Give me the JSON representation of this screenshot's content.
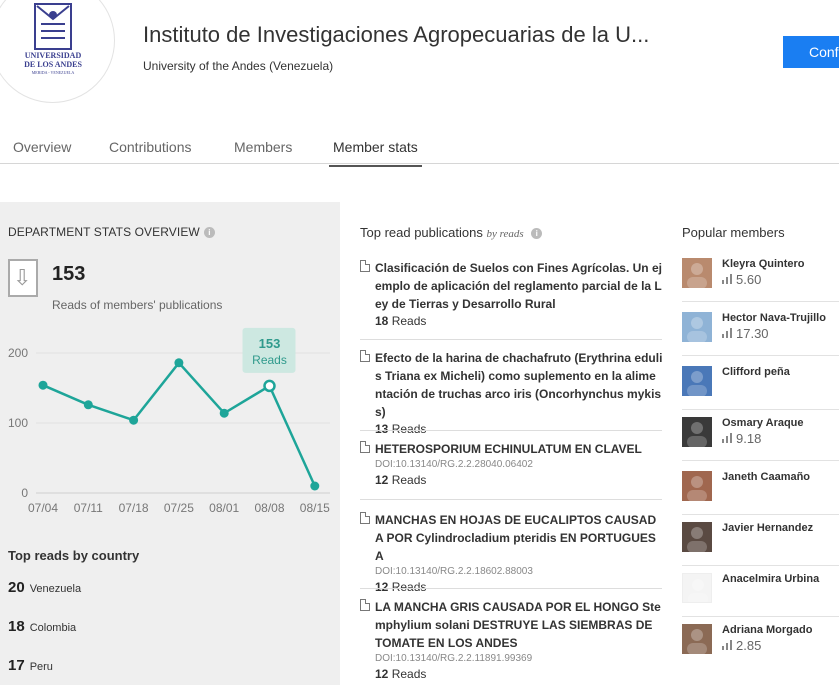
{
  "header": {
    "logo_lines": [
      "UNIVERSIDAD",
      "DE LOS ANDES",
      "MERIDA - VENEZUELA"
    ],
    "title": "Instituto de Investigaciones Agropecuarias de la U...",
    "subtitle": "University of the Andes (Venezuela)",
    "confirm_label": "Conf"
  },
  "tabs": [
    {
      "label": "Overview",
      "active": false
    },
    {
      "label": "Contributions",
      "active": false
    },
    {
      "label": "Members",
      "active": false
    },
    {
      "label": "Member stats",
      "active": true
    }
  ],
  "stats": {
    "heading": "DEPARTMENT STATS OVERVIEW",
    "info_glyph": "i",
    "arrow_glyph": "⇩",
    "reads_total": "153",
    "reads_label": "Reads of members' publications"
  },
  "chart_data": {
    "type": "line",
    "categories": [
      "07/04",
      "07/11",
      "07/18",
      "07/25",
      "08/01",
      "08/08",
      "08/15"
    ],
    "values": [
      154,
      126,
      104,
      186,
      114,
      153,
      10
    ],
    "ylim": [
      0,
      200
    ],
    "yticks": [
      "0",
      "100",
      "200"
    ],
    "highlight": {
      "index": 5,
      "value": "153",
      "label": "Reads"
    },
    "color": "#1ea599",
    "grid": true
  },
  "countries": {
    "title": "Top reads by country",
    "items": [
      {
        "count": "20",
        "name": "Venezuela"
      },
      {
        "count": "18",
        "name": "Colombia"
      },
      {
        "count": "17",
        "name": "Peru"
      }
    ]
  },
  "publications": {
    "title": "Top read publications",
    "by": "by reads",
    "items": [
      {
        "title": "Clasificación de Suelos con Fines Agrícolas. Un ejemplo de aplicación del reglamento parcial de la Ley de Tierras y Desarrollo Rural",
        "doi": "",
        "reads": "18",
        "reads_label": "Reads"
      },
      {
        "title": "Efecto de la harina de chachafruto (Erythrina edulis Triana ex Micheli) como suplemento en la alimentación de truchas arco iris (Oncorhynchus mykiss)",
        "doi": "",
        "reads": "13",
        "reads_label": "Reads"
      },
      {
        "title": "HETEROSPORIUM ECHINULATUM EN CLAVEL",
        "doi": "DOI:10.13140/RG.2.2.28040.06402",
        "reads": "12",
        "reads_label": "Reads"
      },
      {
        "title": "MANCHAS EN HOJAS DE EUCALIPTOS CAUSADA POR Cylindrocladium pteridis EN PORTUGUESA",
        "doi": "DOI:10.13140/RG.2.2.18602.88003",
        "reads": "12",
        "reads_label": "Reads"
      },
      {
        "title": "LA MANCHA GRIS CAUSADA POR EL HONGO Stemphylium solani DESTRUYE LAS SIEMBRAS DE TOMATE EN LOS ANDES",
        "doi": "DOI:10.13140/RG.2.2.11891.99369",
        "reads": "12",
        "reads_label": "Reads"
      }
    ]
  },
  "popular": {
    "title": "Popular members",
    "members": [
      {
        "name": "Kleyra Quintero",
        "score": "5.60",
        "avatar_color": "#b98a6e"
      },
      {
        "name": "Hector Nava-Trujillo",
        "score": "17.30",
        "avatar_color": "#8fb3d6"
      },
      {
        "name": "Clifford peña",
        "score": "",
        "avatar_color": "#4a78b8"
      },
      {
        "name": "Osmary Araque",
        "score": "9.18",
        "avatar_color": "#3a3a3a"
      },
      {
        "name": "Janeth Caamaño",
        "score": "",
        "avatar_color": "#a0674f"
      },
      {
        "name": "Javier Hernandez",
        "score": "",
        "avatar_color": "#5a4a42"
      },
      {
        "name": "Anacelmira Urbina",
        "score": "",
        "avatar_color": "#f4f4f4"
      },
      {
        "name": "Adriana Morgado",
        "score": "2.85",
        "avatar_color": "#8b6a55"
      }
    ]
  }
}
